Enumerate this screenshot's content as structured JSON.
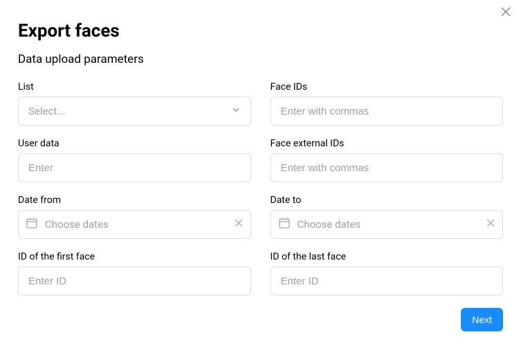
{
  "modal": {
    "title": "Export faces",
    "subtitle": "Data upload parameters"
  },
  "fields": {
    "list": {
      "label": "List",
      "placeholder": "Select..."
    },
    "face_ids": {
      "label": "Face IDs",
      "placeholder": "Enter with commas"
    },
    "user_data": {
      "label": "User data",
      "placeholder": "Enter"
    },
    "face_external_ids": {
      "label": "Face external IDs",
      "placeholder": "Enter with commas"
    },
    "date_from": {
      "label": "Date from",
      "placeholder": "Choose dates"
    },
    "date_to": {
      "label": "Date to",
      "placeholder": "Choose dates"
    },
    "id_first_face": {
      "label": "ID of the first face",
      "placeholder": "Enter ID"
    },
    "id_last_face": {
      "label": "ID of the last face",
      "placeholder": "Enter ID"
    }
  },
  "buttons": {
    "next": "Next"
  }
}
